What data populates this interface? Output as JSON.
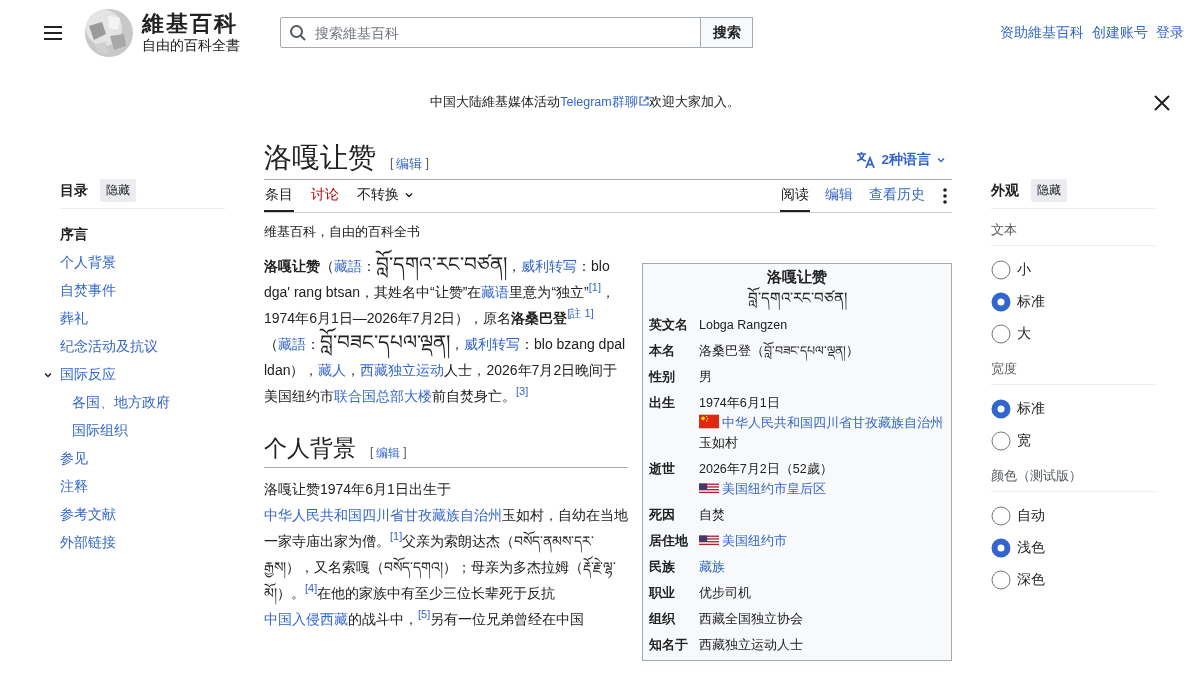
{
  "header": {
    "wordmark": "維基百科",
    "tagline": "自由的百科全書",
    "search": {
      "placeholder": "搜索維基百科",
      "button": "搜索"
    },
    "links": [
      "资助維基百科",
      "创建账号",
      "登录"
    ]
  },
  "banner": {
    "parts": [
      {
        "kind": "text",
        "text": "中国大陆維基媒体活动"
      },
      {
        "kind": "external-link",
        "text": "Telegram群聊"
      },
      {
        "kind": "text",
        "text": "欢迎大家加入。"
      }
    ]
  },
  "toc": {
    "title": "目录",
    "hide": "隐藏",
    "items": [
      {
        "label": "序言",
        "selected": true
      },
      {
        "label": "个人背景",
        "selected": false
      },
      {
        "label": "自焚事件",
        "selected": false
      },
      {
        "label": "葬礼",
        "selected": false
      },
      {
        "label": "纪念活动及抗议",
        "selected": false
      },
      {
        "label": "国际反应",
        "selected": false,
        "expanded": true,
        "children": [
          {
            "label": "各国、地方政府",
            "selected": false
          },
          {
            "label": "国际组织",
            "selected": false
          }
        ]
      },
      {
        "label": "参见",
        "selected": false
      },
      {
        "label": "注释",
        "selected": false
      },
      {
        "label": "参考文献",
        "selected": false
      },
      {
        "label": "外部链接",
        "selected": false
      }
    ]
  },
  "article": {
    "title": "洛嘎让赞",
    "edit": {
      "open": "[",
      "label": "编辑",
      "close": "]"
    },
    "languages": "2种语言",
    "tabs_left": [
      {
        "label": "条目",
        "kind": "tab",
        "exists": true,
        "selected": true
      },
      {
        "label": "讨论",
        "kind": "tab",
        "exists": false,
        "selected": false
      },
      {
        "label": "不转换",
        "kind": "dropdown",
        "exists": true,
        "selected": false
      }
    ],
    "tabs_right": [
      {
        "label": "阅读",
        "selected": true
      },
      {
        "label": "编辑",
        "selected": false
      },
      {
        "label": "查看历史",
        "selected": false
      }
    ],
    "tagline": "维基百科，自由的百科全书",
    "lead": [
      {
        "kind": "bold",
        "text": "洛嘎让赞"
      },
      {
        "kind": "text",
        "text": "（"
      },
      {
        "kind": "link",
        "text": "藏語"
      },
      {
        "kind": "text",
        "text": "："
      },
      {
        "kind": "tibetan",
        "text": "བློ་དགའ་རང་བཙན།"
      },
      {
        "kind": "text",
        "text": "，"
      },
      {
        "kind": "link",
        "text": "威利转写"
      },
      {
        "kind": "text",
        "text": "：blo dga' rang btsan，其姓名中“让赞”在"
      },
      {
        "kind": "link",
        "text": "藏语"
      },
      {
        "kind": "text",
        "text": "里意为“独立”"
      },
      {
        "kind": "ref",
        "text": "[1]"
      },
      {
        "kind": "text",
        "text": "，1974年6月1日—2026年7月2日），原名"
      },
      {
        "kind": "bold",
        "text": "洛桑巴登"
      },
      {
        "kind": "ref",
        "text": "[註 1]"
      },
      {
        "kind": "text",
        "text": "（"
      },
      {
        "kind": "link",
        "text": "藏語"
      },
      {
        "kind": "text",
        "text": "："
      },
      {
        "kind": "tibetan",
        "text": "བློ་བཟང་དཔལ་ལྡན།"
      },
      {
        "kind": "text",
        "text": "，"
      },
      {
        "kind": "link",
        "text": "威利转写"
      },
      {
        "kind": "text",
        "text": "：blo bzang dpal ldan），"
      },
      {
        "kind": "link",
        "text": "藏人"
      },
      {
        "kind": "text",
        "text": "，"
      },
      {
        "kind": "link",
        "text": "西藏独立运动"
      },
      {
        "kind": "text",
        "text": "人士，2026年7月2日晚间于美国纽约市"
      },
      {
        "kind": "link",
        "text": "联合国总部大楼"
      },
      {
        "kind": "text",
        "text": "前自焚身亡。"
      },
      {
        "kind": "ref",
        "text": "[3]"
      }
    ],
    "sections": [
      {
        "heading": "个人背景",
        "edit": {
          "open": "[",
          "label": "编辑",
          "close": "]"
        },
        "paragraph": [
          {
            "kind": "text",
            "text": "洛嘎让赞1974年6月1日出生于"
          },
          {
            "kind": "link",
            "text": "中华人民共和国四川省甘孜藏族自治州"
          },
          {
            "kind": "text",
            "text": "玉如村，自幼在当地一家寺庙出家为僧。"
          },
          {
            "kind": "ref",
            "text": "[1]"
          },
          {
            "kind": "text",
            "text": "父亲为索朗达杰（བསོད་ནམས་དར་རྒྱས།），又名索嘎（བསོད་དགའ།）；母亲为多杰拉姆（རྡོ་རྗེ་ལྷ་མོ།）。"
          },
          {
            "kind": "ref",
            "text": "[4]"
          },
          {
            "kind": "text",
            "text": "在他的家族中有至少三位长辈死于反抗"
          },
          {
            "kind": "link",
            "text": "中国入侵西藏"
          },
          {
            "kind": "text",
            "text": "的战斗中，"
          },
          {
            "kind": "ref",
            "text": "[5]"
          },
          {
            "kind": "text",
            "text": "另有一位兄弟曾经在中国"
          }
        ]
      }
    ],
    "infobox": {
      "title": "洛嘎让赞",
      "subtitle": "བློ་དགའ་རང་བཙན།",
      "rows": [
        {
          "label": "英文名",
          "lines": [
            {
              "parts": [
                {
                  "kind": "text",
                  "text": "Lobga Rangzen"
                }
              ]
            }
          ]
        },
        {
          "label": "本名",
          "lines": [
            {
              "parts": [
                {
                  "kind": "text",
                  "text": "洛桑巴登（བློ་བཟང་དཔལ་ལྡན།）"
                }
              ]
            }
          ]
        },
        {
          "label": "性别",
          "lines": [
            {
              "parts": [
                {
                  "kind": "text",
                  "text": "男"
                }
              ]
            }
          ]
        },
        {
          "label": "出生",
          "lines": [
            {
              "parts": [
                {
                  "kind": "text",
                  "text": "1974年6月1日"
                }
              ]
            },
            {
              "kind": "cn-flag",
              "parts": [
                {
                  "kind": "link",
                  "text": "中华人民共和国四川省甘孜藏族自治州"
                },
                {
                  "kind": "text",
                  "text": "玉如村"
                }
              ]
            }
          ]
        },
        {
          "label": "逝世",
          "lines": [
            {
              "parts": [
                {
                  "kind": "text",
                  "text": "2026年7月2日（52歲）"
                }
              ]
            },
            {
              "kind": "us-flag",
              "parts": [
                {
                  "kind": "link",
                  "text": "美国纽约市皇后区"
                }
              ]
            }
          ]
        },
        {
          "label": "死因",
          "lines": [
            {
              "parts": [
                {
                  "kind": "text",
                  "text": "自焚"
                }
              ]
            }
          ]
        },
        {
          "label": "居住地",
          "lines": [
            {
              "kind": "us-flag",
              "parts": [
                {
                  "kind": "link",
                  "text": "美国纽约市"
                }
              ]
            }
          ]
        },
        {
          "label": "民族",
          "lines": [
            {
              "parts": [
                {
                  "kind": "link",
                  "text": "藏族"
                }
              ]
            }
          ]
        },
        {
          "label": "职业",
          "lines": [
            {
              "parts": [
                {
                  "kind": "text",
                  "text": "优步司机"
                }
              ]
            }
          ]
        },
        {
          "label": "组织",
          "lines": [
            {
              "parts": [
                {
                  "kind": "text",
                  "text": "西藏全国独立协会"
                }
              ]
            }
          ]
        },
        {
          "label": "知名于",
          "lines": [
            {
              "parts": [
                {
                  "kind": "text",
                  "text": "西藏独立运动人士"
                }
              ]
            }
          ]
        }
      ]
    }
  },
  "appearance": {
    "title": "外观",
    "hide": "隐藏",
    "groups": [
      {
        "title": "文本",
        "options": [
          {
            "label": "小",
            "selected": false
          },
          {
            "label": "标准",
            "selected": true
          },
          {
            "label": "大",
            "selected": false
          }
        ]
      },
      {
        "title": "宽度",
        "options": [
          {
            "label": "标准",
            "selected": true
          },
          {
            "label": "宽",
            "selected": false
          }
        ]
      },
      {
        "title": "颜色（测试版）",
        "options": [
          {
            "label": "自动",
            "selected": false
          },
          {
            "label": "浅色",
            "selected": true
          },
          {
            "label": "深色",
            "selected": false
          }
        ]
      }
    ]
  }
}
